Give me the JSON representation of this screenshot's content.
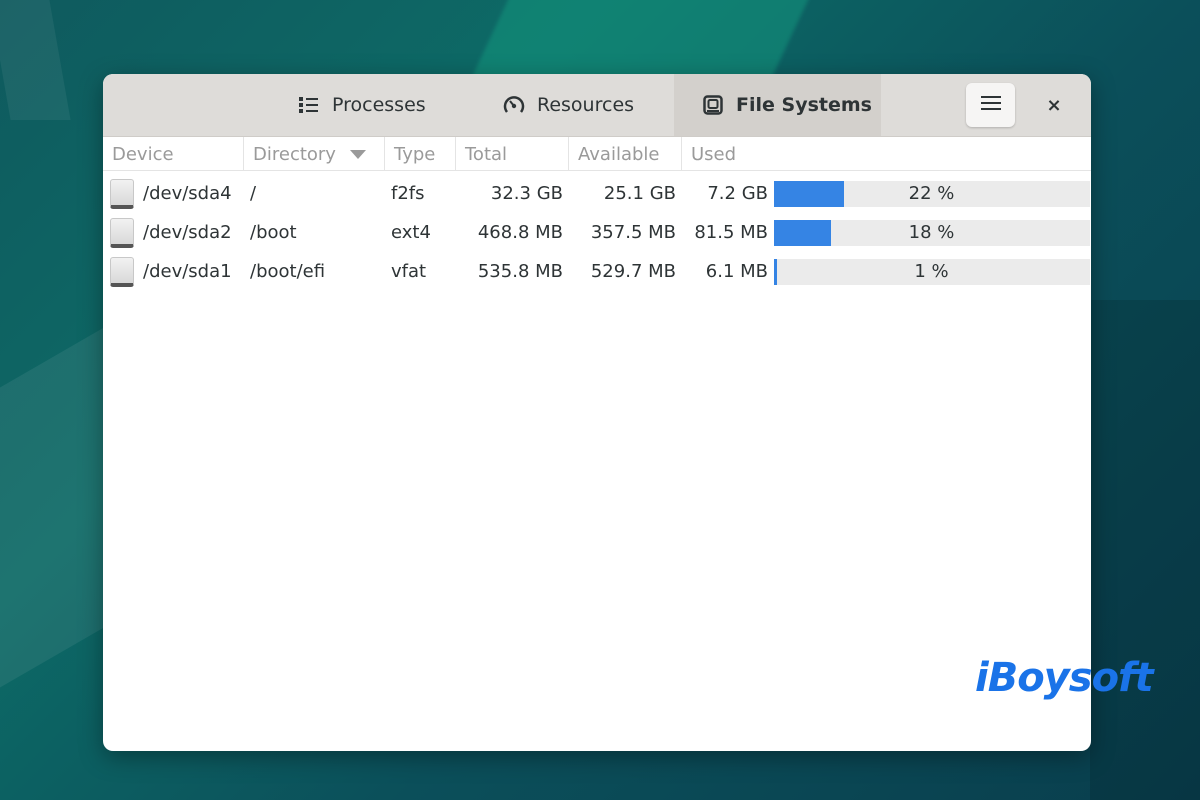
{
  "window": {
    "tabs": [
      {
        "label": "Processes",
        "icon": "list-icon",
        "active": false
      },
      {
        "label": "Resources",
        "icon": "gauge-icon",
        "active": false
      },
      {
        "label": "File Systems",
        "icon": "disk-icon",
        "active": true
      }
    ],
    "menu_icon": "hamburger-menu-icon",
    "close_label": "×"
  },
  "table": {
    "columns": [
      "Device",
      "Directory",
      "Type",
      "Total",
      "Available",
      "Used"
    ],
    "sort_column": "Directory",
    "rows": [
      {
        "device": "/dev/sda4",
        "directory": "/",
        "type": "f2fs",
        "total": "32.3 GB",
        "available": "25.1 GB",
        "used": "7.2 GB",
        "percent": 22,
        "percent_label": "22 %"
      },
      {
        "device": "/dev/sda2",
        "directory": "/boot",
        "type": "ext4",
        "total": "468.8 MB",
        "available": "357.5 MB",
        "used": "81.5 MB",
        "percent": 18,
        "percent_label": "18 %"
      },
      {
        "device": "/dev/sda1",
        "directory": "/boot/efi",
        "type": "vfat",
        "total": "535.8 MB",
        "available": "529.7 MB",
        "used": "6.1 MB",
        "percent": 1,
        "percent_label": "1 %"
      }
    ]
  },
  "colors": {
    "accent": "#3584e4",
    "watermark": "#1a73e8"
  },
  "watermark": "iBoysoft"
}
